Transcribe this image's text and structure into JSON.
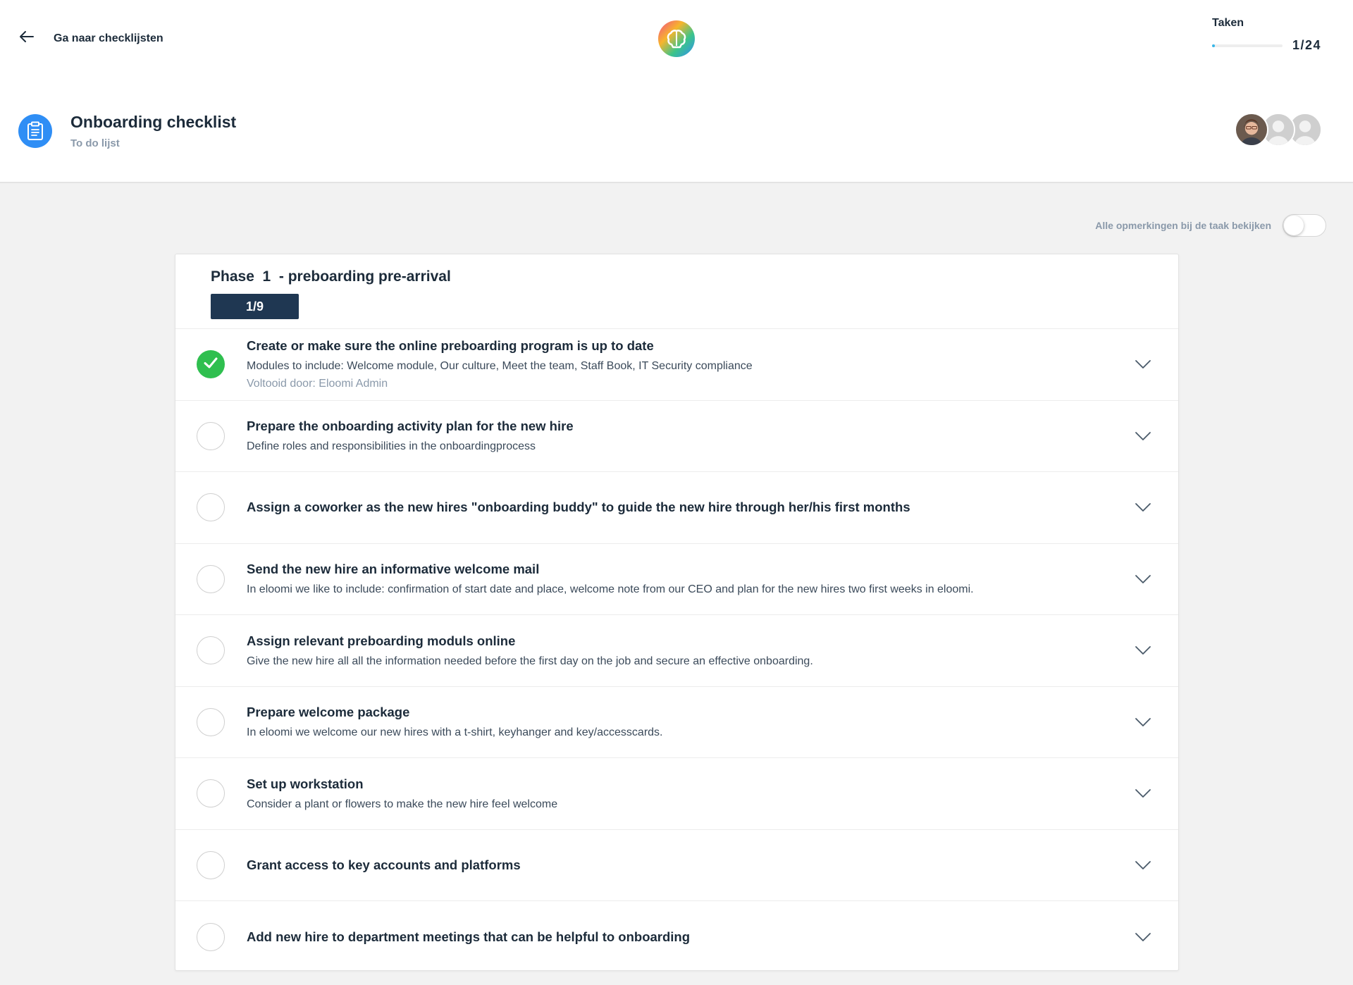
{
  "header": {
    "back_label": "Ga naar checklijsten",
    "progress": {
      "title": "Taken",
      "count": "1/24",
      "fraction": 0.04167
    },
    "accent_color": "#38b6e8"
  },
  "checklist": {
    "title": "Onboarding checklist",
    "subtitle": "To do lijst"
  },
  "comments_toggle": {
    "label": "Alle opmerkingen bij de taak bekijken",
    "on": false
  },
  "phase": {
    "title": "Phase  1  - preboarding pre-arrival",
    "badge": "1/9"
  },
  "tasks": [
    {
      "title": "Create or make sure the online preboarding program is up to date",
      "desc": "Modules to include: Welcome module, Our culture, Meet the team, Staff Book, IT Security compliance",
      "done_by": "Voltooid door: Eloomi Admin",
      "done": true
    },
    {
      "title": "Prepare the onboarding activity plan for the new hire",
      "desc": "Define roles and responsibilities in the onboardingprocess",
      "done": false
    },
    {
      "title": "Assign a coworker as the new hires \"onboarding buddy\" to guide the new hire through her/his first months",
      "desc": "",
      "done": false
    },
    {
      "title": "Send the new hire an informative welcome mail",
      "desc": "In eloomi we like to include: confirmation of start date and place, welcome note from our CEO and plan for the new hires two first weeks in eloomi.",
      "done": false
    },
    {
      "title": "Assign relevant preboarding moduls online",
      "desc": "Give the new hire all all the information needed before the first day on the job and secure an effective onboarding.",
      "done": false
    },
    {
      "title": "Prepare welcome package",
      "desc": "In eloomi we welcome our new hires with a t-shirt, keyhanger and key/accesscards.",
      "done": false
    },
    {
      "title": "Set up workstation",
      "desc": "Consider a plant or flowers to make the new hire feel welcome",
      "done": false
    },
    {
      "title": "Grant access to key accounts and platforms",
      "desc": "",
      "done": false
    },
    {
      "title": "Add new hire to department meetings that can be helpful to onboarding",
      "desc": "",
      "done": false
    }
  ]
}
